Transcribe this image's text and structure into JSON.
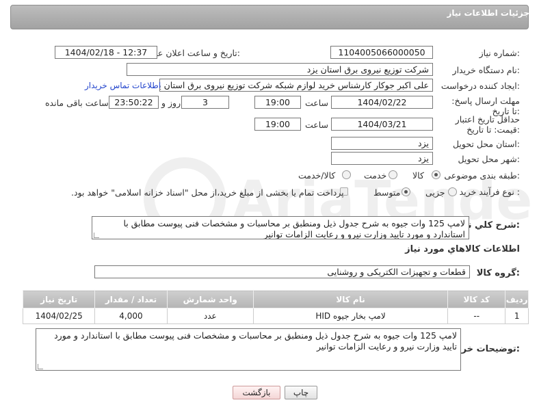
{
  "header": {
    "title": "جزئیات اطلاعات نیاز"
  },
  "fields": {
    "need_number": {
      "label": "شماره نیاز:",
      "value": "1104005066000050"
    },
    "announce_datetime": {
      "label": "تاریخ و ساعت اعلان عمومی:",
      "value": "1404/02/18 - 12:37"
    },
    "buyer_org": {
      "label": "نام دستگاه خریدار:",
      "value": "شرکت توزیع نیروی برق استان یزد"
    },
    "requester": {
      "label": "ایجاد کننده درخواست:",
      "value": "علی اکبر  جوکار  کارشناس خرید لوازم شبکه  شرکت توزیع نیروی برق استان یزد",
      "contact_link": "اطلاعات تماس خریدار"
    },
    "reply_deadline": {
      "label": "مهلت ارسال پاسخ: تا تاریخ:",
      "date": "1404/02/22",
      "time_label": "ساعت",
      "time": "19:00",
      "days": "3",
      "days_label": "روز و",
      "remaining": "23:50:22",
      "remaining_label": "ساعت باقی مانده"
    },
    "price_validity": {
      "label": "حداقل تاریخ اعتبار قیمت: تا تاریخ:",
      "date": "1404/03/21",
      "time_label": "ساعت",
      "time": "19:00"
    },
    "delivery_province": {
      "label": "استان محل تحویل:",
      "value": "یزد"
    },
    "delivery_city": {
      "label": "شهر محل تحویل:",
      "value": "یزد"
    },
    "category": {
      "label": "طبقه بندی موضوعی:",
      "options": [
        "کالا",
        "خدمت",
        "کالا/خدمت"
      ],
      "selected": "کالا"
    },
    "purchase_process": {
      "label": "نوع فرآیند خرید :",
      "options": [
        "جزیی",
        "متوسط"
      ],
      "selected": "متوسط",
      "payment_note": "پرداخت تمام یا بخشی از مبلغ خرید،از محل \"اسناد خزانه اسلامی\" خواهد بود."
    },
    "general_desc": {
      "label": "شرح کلي نياز:",
      "value": "لامپ 125 وات جیوه  به شرح جدول ذیل ومنطبق بر  محاسبات و مشخصات فنی پیوست مطابق با استاندارد و مورد تایید وزارت نیرو و رعایت الزامات توانیر"
    }
  },
  "goods_section": {
    "title": "اطلاعات کالاهاي مورد نياز",
    "group_label": "گروه کالا:",
    "group_value": "قطعات و تجهیزات الکتریکی و روشنایی"
  },
  "table": {
    "headers": [
      "ردیف",
      "کد کالا",
      "نام کالا",
      "واحد شمارش",
      "تعداد / مقدار",
      "تاریخ نیاز"
    ],
    "rows": [
      [
        "1",
        "--",
        "لامپ بخار جیوه HID",
        "عدد",
        "4,000",
        "1404/02/25"
      ]
    ]
  },
  "buyer_notes": {
    "label": "توضیحات خریدار:",
    "value": "لامپ 125 وات جیوه  به شرح جدول ذیل ومنطبق بر  محاسبات و مشخصات فنی پیوست مطابق با استاندارد و مورد تایید وزارت نیرو و رعایت الزامات توانیر"
  },
  "buttons": {
    "print": "چاپ",
    "back": "بازگشت"
  },
  "watermark": "AriaTender.neT"
}
